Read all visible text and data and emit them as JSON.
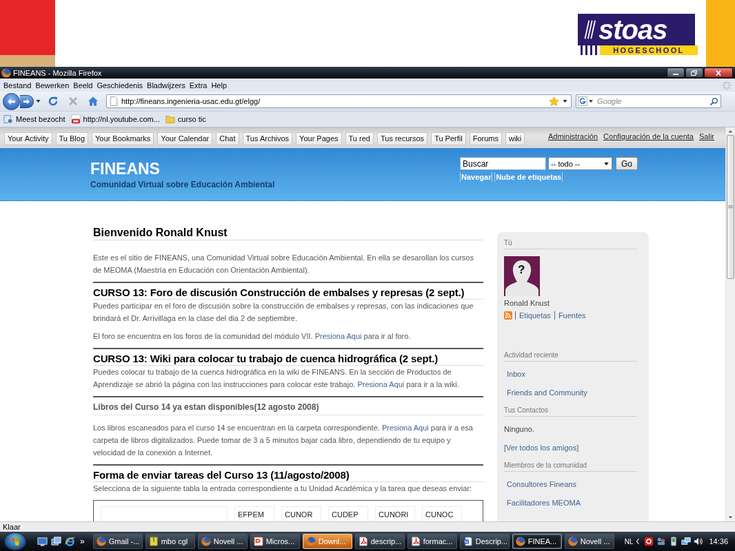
{
  "slide": {
    "logo_word": "stoas",
    "logo_subtitle": "HOGESCHOOL"
  },
  "window": {
    "title": "FINEANS - Mozilla Firefox"
  },
  "menu_bar": [
    "Bestand",
    "Bewerken",
    "Beeld",
    "Geschiedenis",
    "Bladwijzers",
    "Extra",
    "Help"
  ],
  "nav_bar": {
    "url": "http://fineans.ingenieria-usac.edu.gt/elgg/",
    "search_placeholder": "Google",
    "stop_disabled": true
  },
  "bookmarks": [
    {
      "kind": "smart",
      "label": "Meest bezocht"
    },
    {
      "kind": "video",
      "label": "http://nl.youtube.com..."
    },
    {
      "kind": "folder",
      "label": "curso tic"
    }
  ],
  "site_toolbar": {
    "buttons": [
      "Your Activity",
      "Tu Blog",
      "Your Bookmarks",
      "Your Calendar",
      "Chat",
      "Tus Archivos",
      "Your Pages",
      "Tu red",
      "Tus recursos",
      "Tu Perfil",
      "Forums",
      "wiki"
    ],
    "links": [
      "Administración",
      "Configuración de la cuenta",
      "Salir"
    ]
  },
  "site_header": {
    "title": "FINEANS",
    "subtitle": "Comunidad Virtual sobre Educación Ambiental",
    "search": {
      "value": "Buscar",
      "scope": "-- todo --",
      "button": "Go"
    },
    "links": [
      "Navegar",
      "Nube de etiquetas"
    ]
  },
  "content": {
    "blocks": [
      {
        "kind": "title",
        "text": "Bienvenido Ronald Knust"
      },
      {
        "kind": "paragraph",
        "parts": [
          {
            "kind": "text",
            "text": "Este es el sitio de FINEANS, una Comunidad Virtual sobre Educación Ambiental. En ella se desarollan los cursos de MEOMA (Maestría en Educación con Orientación Ambiental)."
          }
        ]
      },
      {
        "kind": "heading",
        "text": "CURSO 13: Foro de discusión Construcción de embalses y represas (2 sept.)"
      },
      {
        "kind": "paragraph",
        "parts": [
          {
            "kind": "text",
            "text": "Puedes participar en el foro de discusión sobre la construcción de embalses y represas, con las indicaciones que brindará el Dr. Arrivillaga en la clase del dia 2 de septiembre."
          }
        ]
      },
      {
        "kind": "paragraph",
        "parts": [
          {
            "kind": "text",
            "text": "El foro se encuentra en los foros de la comunidad del módulo VII. "
          },
          {
            "kind": "link",
            "text": "Presiona Aqui"
          },
          {
            "kind": "text",
            "text": " para ir al foro."
          }
        ]
      },
      {
        "kind": "heading",
        "text": "CURSO 13: Wiki para colocar tu trabajo de cuenca hidrográfica (2 sept.)"
      },
      {
        "kind": "paragraph",
        "parts": [
          {
            "kind": "text",
            "text": "Puedes colocar tu trabajo de la cuenca hidrográfica en la wiki de FINEANS. En la sección de Productos de Aprendizaje se abrió la página con las instrucciones para colocar este trabajo. "
          },
          {
            "kind": "link",
            "text": "Presiona Aqui"
          },
          {
            "kind": "text",
            "text": " para ir a la wiki."
          }
        ]
      },
      {
        "kind": "subheading",
        "text": "Libros del Curso 14 ya estan disponibles(12 agosto 2008)"
      },
      {
        "kind": "paragraph",
        "parts": [
          {
            "kind": "text",
            "text": "Los libros escaneados para el curso 14 se encuentran en la carpeta correspondiente. "
          },
          {
            "kind": "link",
            "text": "Presiona Aqui"
          },
          {
            "kind": "text",
            "text": " para ir a esa carpeta de libros digitalizados. Puede tomar de 3 a 5 minutos bajar cada libro, dependiendo de tu equipo y velocidad de la conexión a Internet."
          }
        ]
      },
      {
        "kind": "heading",
        "text": "Forma de enviar tareas del Curso 13 (11/agosto/2008)"
      },
      {
        "kind": "paragraph",
        "parts": [
          {
            "kind": "text",
            "text": "Selecciona de la siguiente tabla la entrada correspondiente a tu Unidad Académica y la tarea que deseas enviar:"
          }
        ]
      },
      {
        "kind": "table",
        "columns": [
          "EFPEM",
          "CUNOR",
          "CUDEP",
          "CUNORI",
          "CUNOC"
        ]
      }
    ]
  },
  "sidebar": {
    "profile": {
      "heading": "Tú",
      "avatar_mark": "?",
      "name": "Ronald Knust",
      "links": [
        "Etiquetas",
        "Fuentes"
      ]
    },
    "sections": [
      {
        "heading": "Actividad reciente",
        "items": [
          {
            "kind": "menu",
            "text": "Inbox"
          },
          {
            "kind": "menu",
            "text": "Friends and Community"
          }
        ]
      },
      {
        "heading": "Tus Contactos",
        "items": [
          {
            "kind": "text",
            "text": "Ninguno."
          },
          {
            "kind": "link",
            "text": "[Ver todos los amigos]"
          }
        ]
      },
      {
        "heading": "Miembros de la comunidad",
        "items": [
          {
            "kind": "menu",
            "text": "Consultores Fineans"
          },
          {
            "kind": "menu",
            "text": "Facilitadores MEOMA"
          }
        ]
      }
    ]
  },
  "status_bar": {
    "text": "Klaar"
  },
  "taskbar": {
    "more": "»",
    "tasks": [
      {
        "kind": "browser",
        "label": "Gmail -...",
        "selected": false,
        "flashing": false
      },
      {
        "kind": "archive",
        "label": "mbo cgl",
        "selected": false,
        "flashing": false
      },
      {
        "kind": "browser",
        "label": "Novell ...",
        "selected": false,
        "flashing": false
      },
      {
        "kind": "slides",
        "label": "Micros...",
        "selected": false,
        "flashing": false
      },
      {
        "kind": "browser",
        "label": "Downl...",
        "selected": false,
        "flashing": true
      },
      {
        "kind": "pdf",
        "label": "descrip...",
        "selected": false,
        "flashing": false
      },
      {
        "kind": "pdf",
        "label": "formac...",
        "selected": false,
        "flashing": false
      },
      {
        "kind": "document",
        "label": "Descrip...",
        "selected": false,
        "flashing": false
      },
      {
        "kind": "browser",
        "label": "FINEA...",
        "selected": true,
        "flashing": false
      },
      {
        "kind": "browser",
        "label": "Novell ...",
        "selected": false,
        "flashing": false
      }
    ],
    "language": "NL",
    "clock": "14:36"
  }
}
